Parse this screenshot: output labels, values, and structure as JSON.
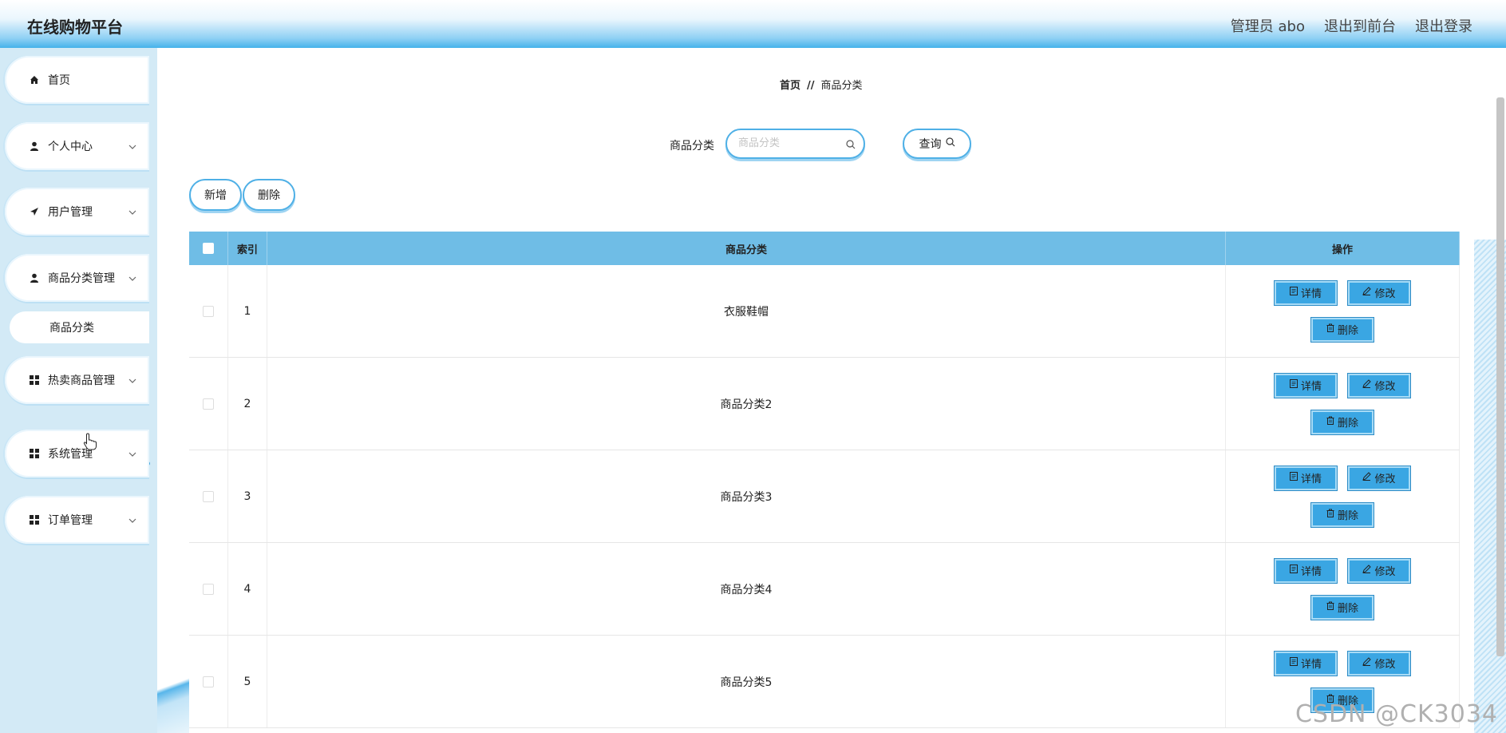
{
  "header": {
    "brand": "在线购物平台",
    "admin": "管理员 abo",
    "to_front": "退出到前台",
    "logout": "退出登录"
  },
  "sidebar": {
    "items": [
      {
        "label": "首页",
        "icon": "home-icon"
      },
      {
        "label": "个人中心",
        "icon": "user-icon"
      },
      {
        "label": "用户管理",
        "icon": "send-icon"
      },
      {
        "label": "商品分类管理",
        "icon": "user-icon"
      },
      {
        "label": "商品分类",
        "icon": ""
      },
      {
        "label": "热卖商品管理",
        "icon": "grid-icon"
      },
      {
        "label": "系统管理",
        "icon": "grid-icon"
      },
      {
        "label": "订单管理",
        "icon": "grid-icon"
      }
    ]
  },
  "breadcrumb": {
    "home": "首页",
    "sep": "//",
    "current": "商品分类"
  },
  "search": {
    "label": "商品分类",
    "placeholder": "商品分类",
    "button": "查询"
  },
  "actions": {
    "add": "新增",
    "delete": "删除"
  },
  "table": {
    "headers": [
      "索引",
      "商品分类",
      "操作"
    ],
    "rows": [
      {
        "index": "1",
        "category": "衣服鞋帽"
      },
      {
        "index": "2",
        "category": "商品分类2"
      },
      {
        "index": "3",
        "category": "商品分类3"
      },
      {
        "index": "4",
        "category": "商品分类4"
      },
      {
        "index": "5",
        "category": "商品分类5"
      }
    ],
    "op_detail": "详情",
    "op_edit": "修改",
    "op_delete": "删除"
  },
  "watermark": "CSDN @CK3034",
  "colors": {
    "header_blue": "#45b2ea",
    "table_head": "#6fbde6",
    "op_button": "#3aa6e3",
    "sidebar_bg": "#d3eaf6"
  }
}
